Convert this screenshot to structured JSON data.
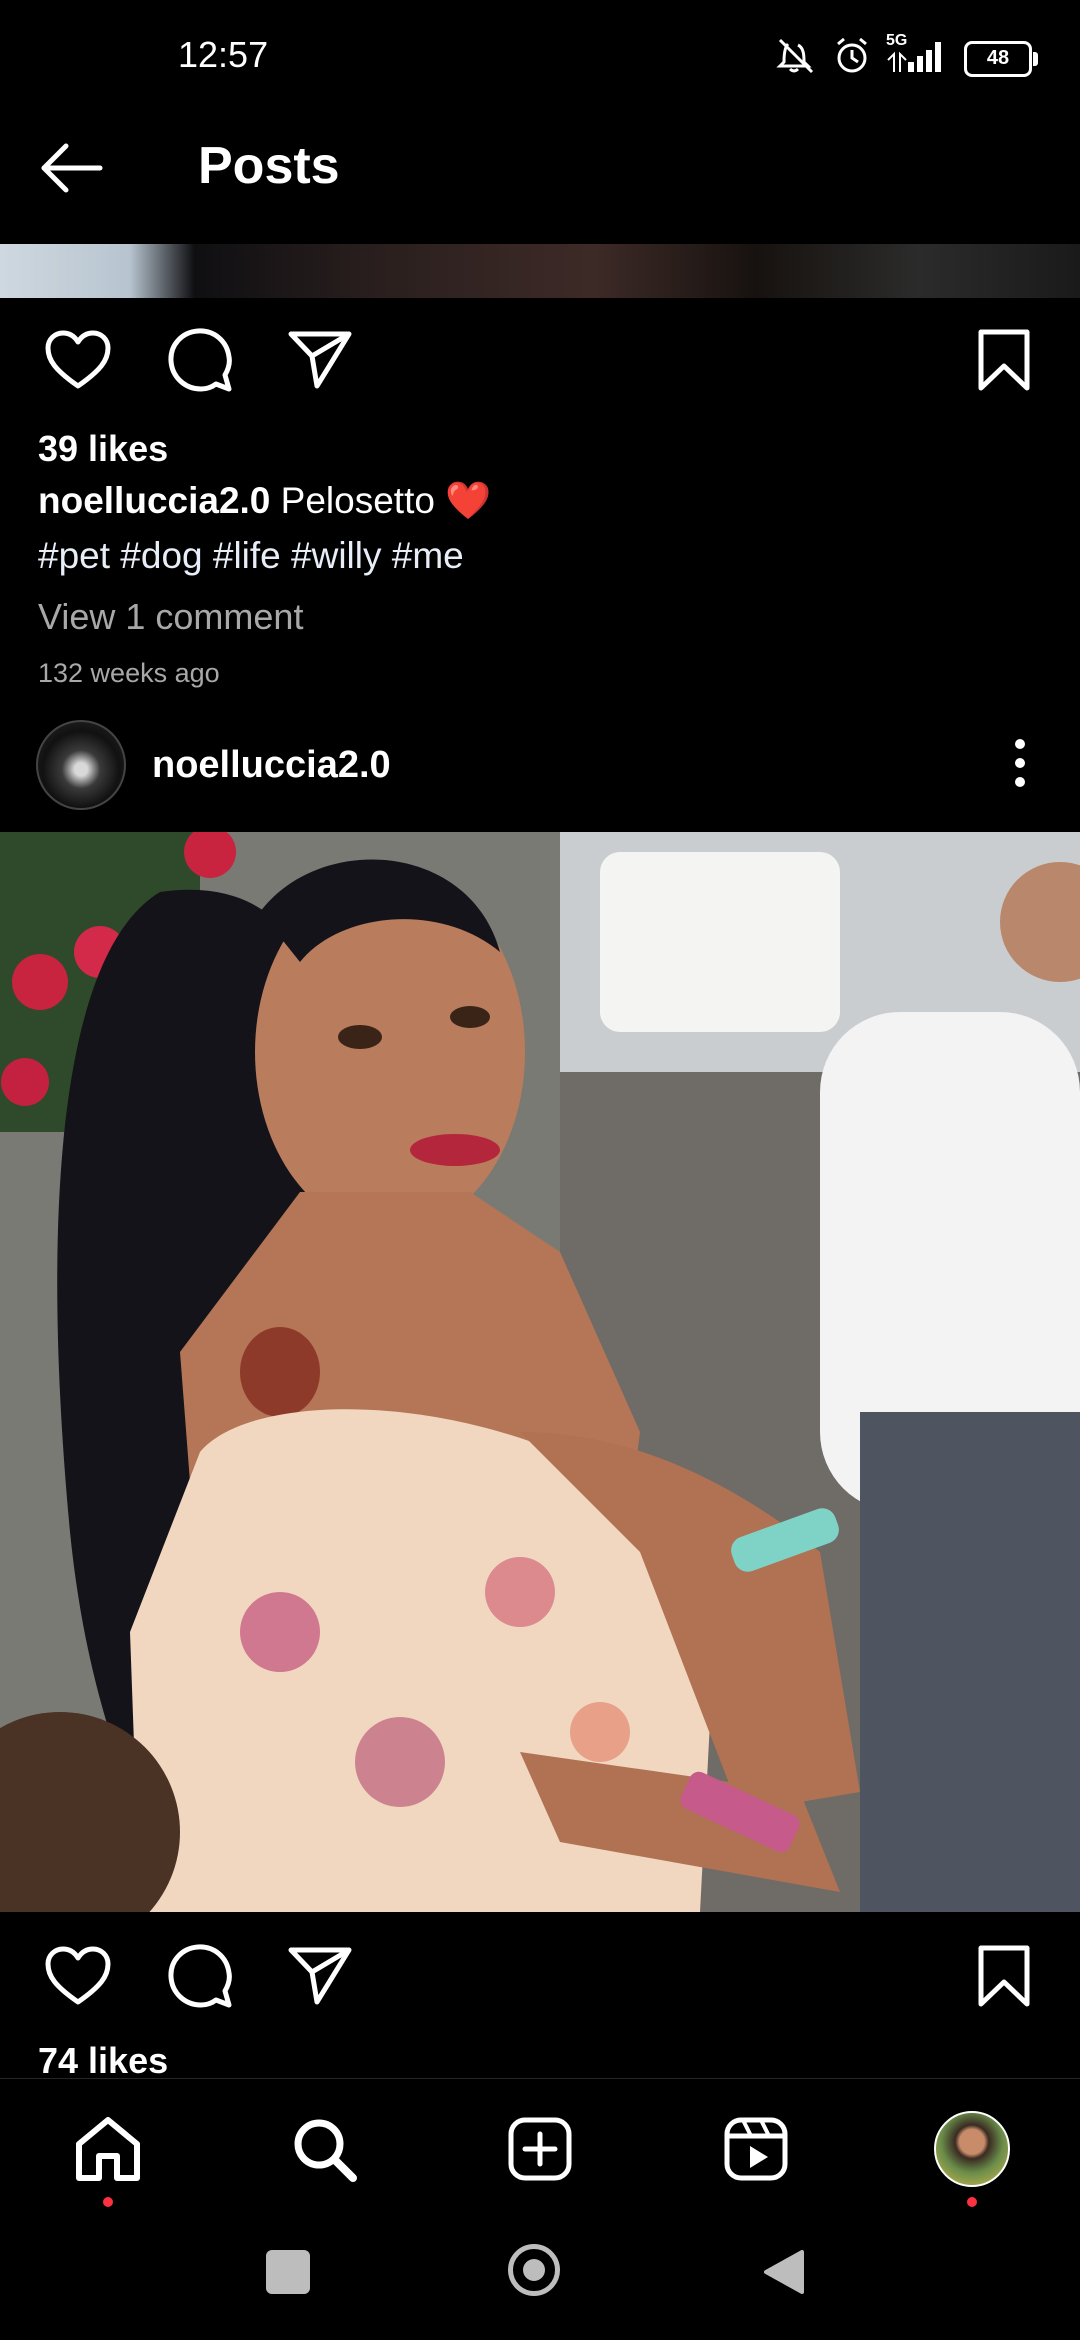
{
  "status_bar": {
    "time": "12:57",
    "network": "5G",
    "battery": "48",
    "icons": [
      "mute-vibrate-icon",
      "alarm-icon",
      "signal-icon",
      "battery-icon"
    ]
  },
  "header": {
    "title": "Posts",
    "back_icon": "arrow-left-icon"
  },
  "posts": [
    {
      "likes": "39 likes",
      "caption_user": "noelluccia2.0",
      "caption_text": "Pelosetto ❤️",
      "hashtags": "#pet #dog #life #willy #me",
      "view_comments": "View 1 comment",
      "timestamp": "132 weeks ago"
    },
    {
      "username": "noelluccia2.0",
      "likes": "74 likes"
    }
  ],
  "bottom_nav": [
    "home-icon",
    "search-icon",
    "create-icon",
    "reels-icon",
    "profile-avatar"
  ],
  "system_nav": [
    "recents-button",
    "home-button",
    "back-button"
  ],
  "colors": {
    "background": "#000000",
    "secondary_text": "#a8a8a8",
    "notification_dot": "#ff3040"
  }
}
